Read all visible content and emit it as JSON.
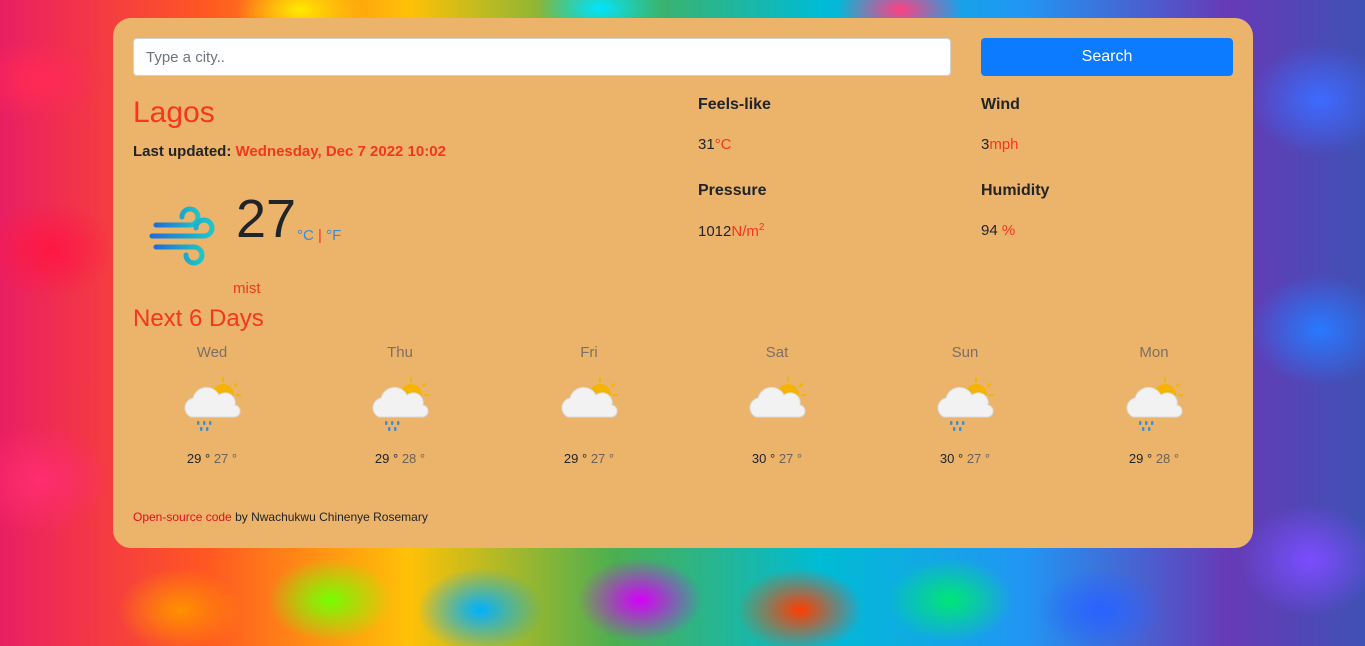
{
  "search": {
    "placeholder": "Type a city..",
    "button_label": "Search"
  },
  "current": {
    "city": "Lagos",
    "last_updated_label": "Last updated:",
    "last_updated_value": "Wednesday, Dec 7 2022 10:02",
    "temperature": "27",
    "unit_c": "°C",
    "unit_sep": "|",
    "unit_f": "°F",
    "description": "mist",
    "icon": "wind-icon"
  },
  "stats": {
    "feels_like": {
      "label": "Feels-like",
      "value": "31",
      "unit": "°C"
    },
    "wind": {
      "label": "Wind",
      "value": "3",
      "unit": "mph"
    },
    "pressure": {
      "label": "Pressure",
      "value": "1012",
      "unit": "N/m",
      "sup": "2"
    },
    "humidity": {
      "label": "Humidity",
      "value": "94 ",
      "unit": "%"
    }
  },
  "forecast_title": "Next 6 Days",
  "forecast": [
    {
      "day": "Wed",
      "max": "29 °",
      "min": "27 °",
      "icon": "rain-cloud-sun-icon"
    },
    {
      "day": "Thu",
      "max": "29 °",
      "min": "28 °",
      "icon": "rain-cloud-sun-icon"
    },
    {
      "day": "Fri",
      "max": "29 °",
      "min": "27 °",
      "icon": "cloud-sun-icon"
    },
    {
      "day": "Sat",
      "max": "30 °",
      "min": "27 °",
      "icon": "cloud-sun-icon"
    },
    {
      "day": "Sun",
      "max": "30 °",
      "min": "27 °",
      "icon": "rain-cloud-sun-icon"
    },
    {
      "day": "Mon",
      "max": "29 °",
      "min": "28 °",
      "icon": "rain-cloud-sun-icon"
    }
  ],
  "footer": {
    "link_text": "Open-source code",
    "credit": " by Nwachukwu Chinenye Rosemary"
  },
  "colors": {
    "card": "#ecb36a",
    "accent": "#f5371e",
    "button": "#0d7bff",
    "unit_blue": "#3b8bd6"
  }
}
